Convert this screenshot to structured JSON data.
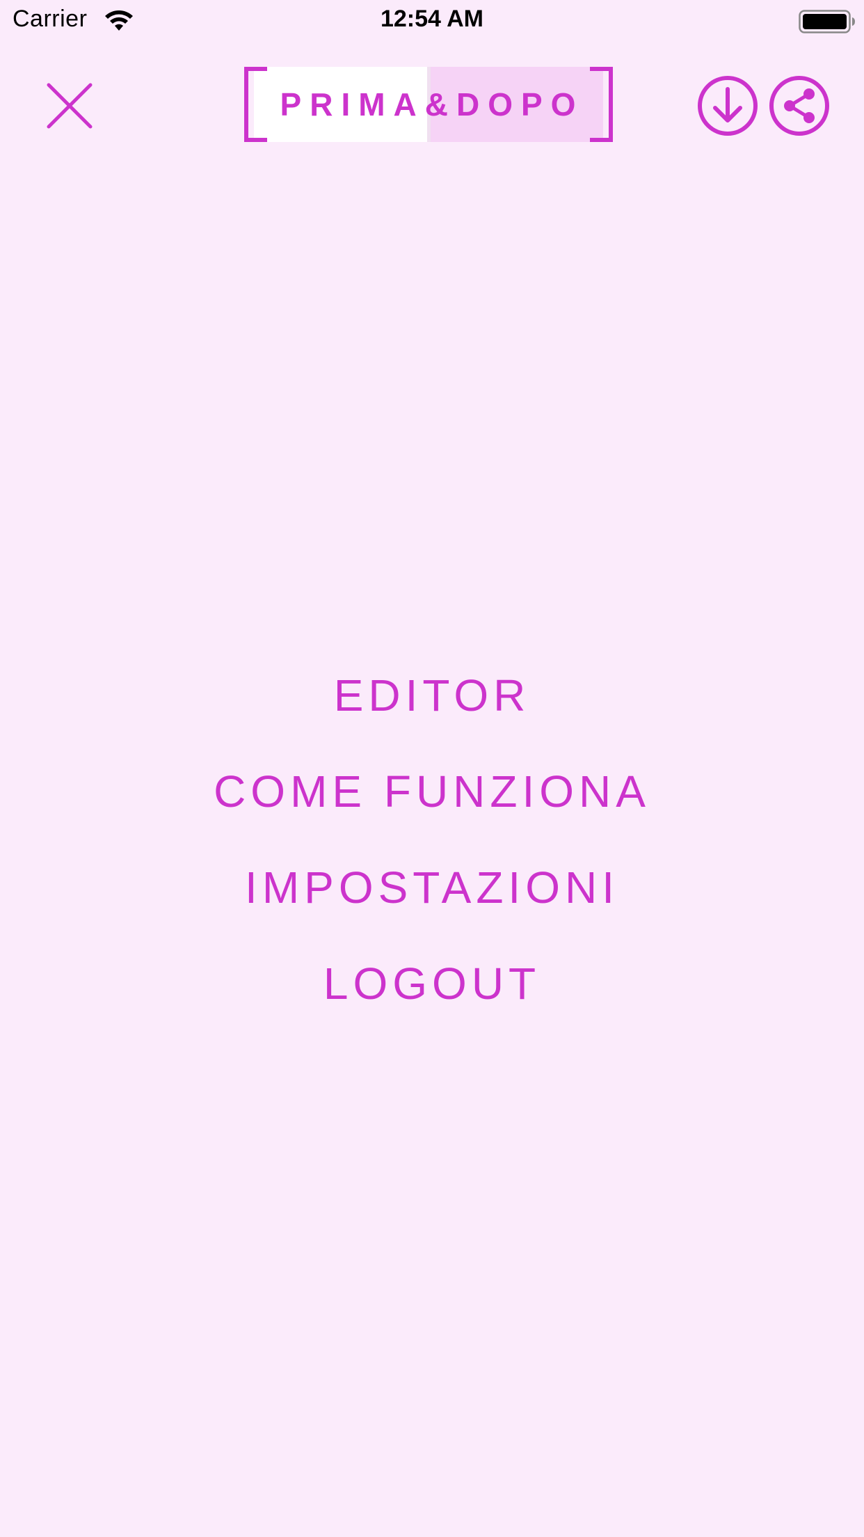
{
  "status_bar": {
    "carrier": "Carrier",
    "time": "12:54 AM",
    "icons": [
      "wifi-icon",
      "battery-icon"
    ]
  },
  "header": {
    "close_icon": "close-icon",
    "logo_text": "PRIMA&DOPO",
    "download_icon": "download-icon",
    "share_icon": "share-icon"
  },
  "menu": {
    "items": [
      {
        "label": "EDITOR"
      },
      {
        "label": "COME FUNZIONA"
      },
      {
        "label": "IMPOSTAZIONI"
      },
      {
        "label": "LOGOUT"
      }
    ]
  },
  "colors": {
    "background": "#fbebfb",
    "accent": "#cc33cc",
    "logo_left_panel": "#ffffff",
    "logo_right_panel": "#f6d3f6"
  }
}
